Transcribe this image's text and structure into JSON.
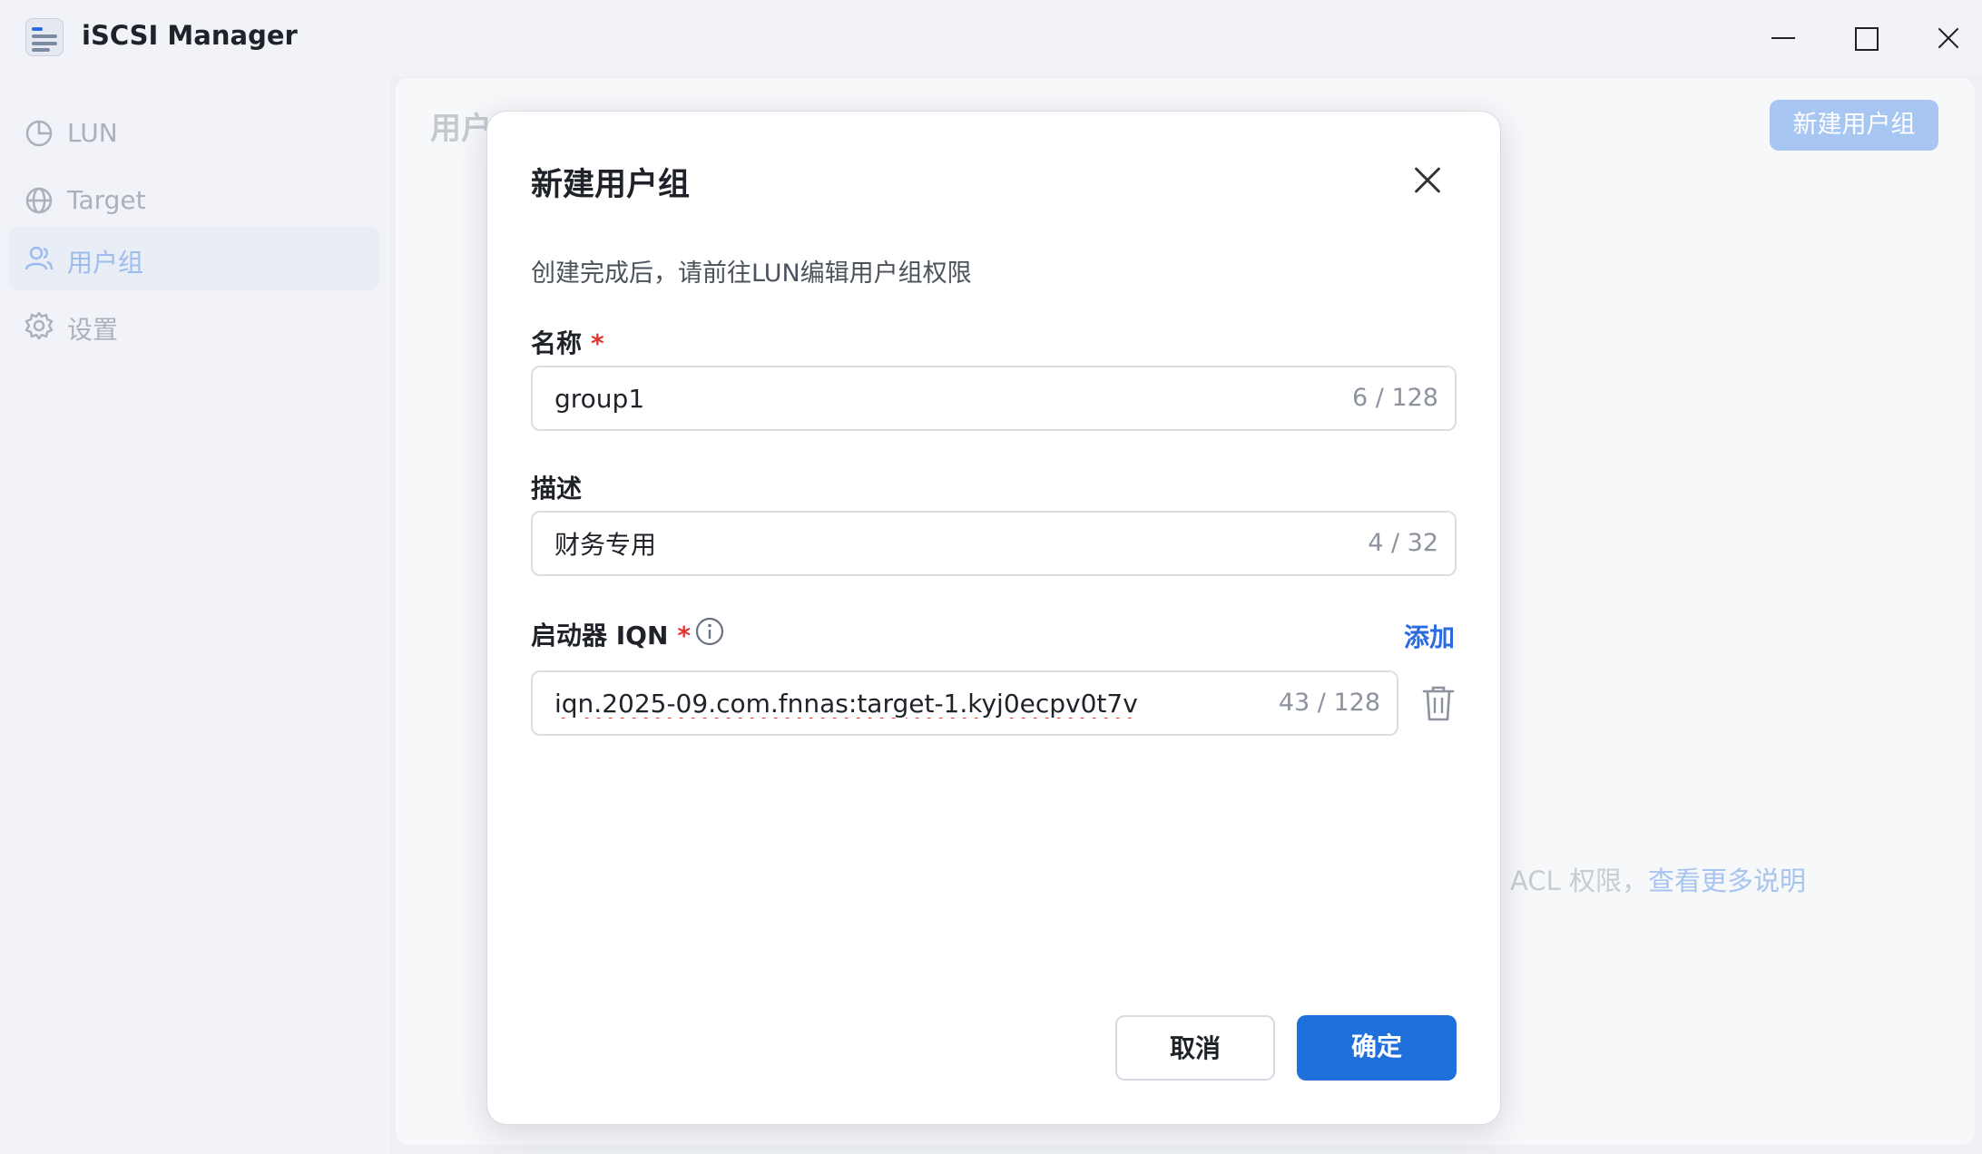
{
  "window": {
    "title": "iSCSI Manager"
  },
  "sidebar": {
    "items": [
      {
        "label": "LUN",
        "icon": "pie-chart-icon",
        "active": false
      },
      {
        "label": "Target",
        "icon": "globe-icon",
        "active": false
      },
      {
        "label": "用户组",
        "icon": "users-icon",
        "active": true
      },
      {
        "label": "设置",
        "icon": "gear-icon",
        "active": false
      }
    ]
  },
  "main": {
    "title": "用户组",
    "new_group_button": "新建用户组",
    "hint_text": "ACL 权限，",
    "hint_link": "查看更多说明"
  },
  "modal": {
    "title": "新建用户组",
    "description": "创建完成后，请前往LUN编辑用户组权限",
    "name_field": {
      "label": "名称",
      "required_mark": "*",
      "value": "group1",
      "counter": "6 / 128"
    },
    "desc_field": {
      "label": "描述",
      "value": "财务专用",
      "counter": "4 / 32"
    },
    "iqn_field": {
      "label": "启动器 IQN",
      "required_mark": "*",
      "add_label": "添加",
      "value": "iqn.2025-09.com.fnnas:target-1.kyj0ecpv0t7v",
      "counter": "43 / 128"
    },
    "cancel_label": "取消",
    "confirm_label": "确定"
  },
  "colors": {
    "accent": "#1f6fdc",
    "required": "#e5342f",
    "link": "#2a6be0"
  }
}
